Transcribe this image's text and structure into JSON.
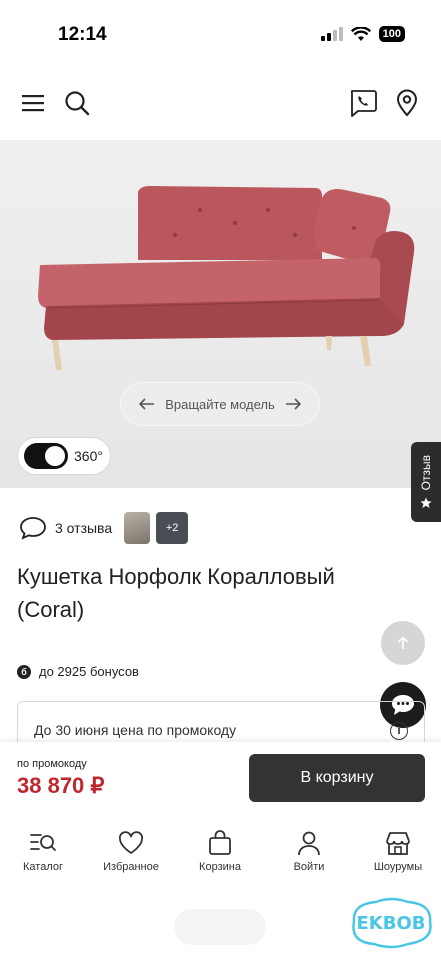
{
  "status_bar": {
    "time": "12:14",
    "battery": "100"
  },
  "top_nav": {
    "menu_icon": "hamburger-icon",
    "search_icon": "search-icon",
    "phone_icon": "phone-chat-icon",
    "location_icon": "location-pin-icon"
  },
  "hero": {
    "rotate_hint": "Вращайте модель",
    "toggle_label": "360°",
    "reviews_tab_label": "Отзыв"
  },
  "reviews": {
    "count_label": "3 отзыва",
    "more_photos": "+2"
  },
  "product": {
    "title": "Кушетка Норфолк Коралловый (Coral)",
    "bonus_badge": "б",
    "bonus_text": "до 2925 бонусов"
  },
  "promo": {
    "text": "До 30 июня цена по промокоду",
    "info": "i"
  },
  "buy_bar": {
    "promo_label": "по промокоду",
    "price": "38 870 ₽",
    "cart_button": "В корзину"
  },
  "tabs": [
    {
      "label": "Каталог",
      "icon": "catalog-icon"
    },
    {
      "label": "Избранное",
      "icon": "heart-icon"
    },
    {
      "label": "Корзина",
      "icon": "bag-icon"
    },
    {
      "label": "Войти",
      "icon": "user-icon"
    },
    {
      "label": "Шоурумы",
      "icon": "store-icon"
    }
  ],
  "watermark": {
    "text": "EKBOB"
  },
  "colors": {
    "price": "#c0262d",
    "sofa": "#b8565a",
    "dark": "#333333"
  }
}
